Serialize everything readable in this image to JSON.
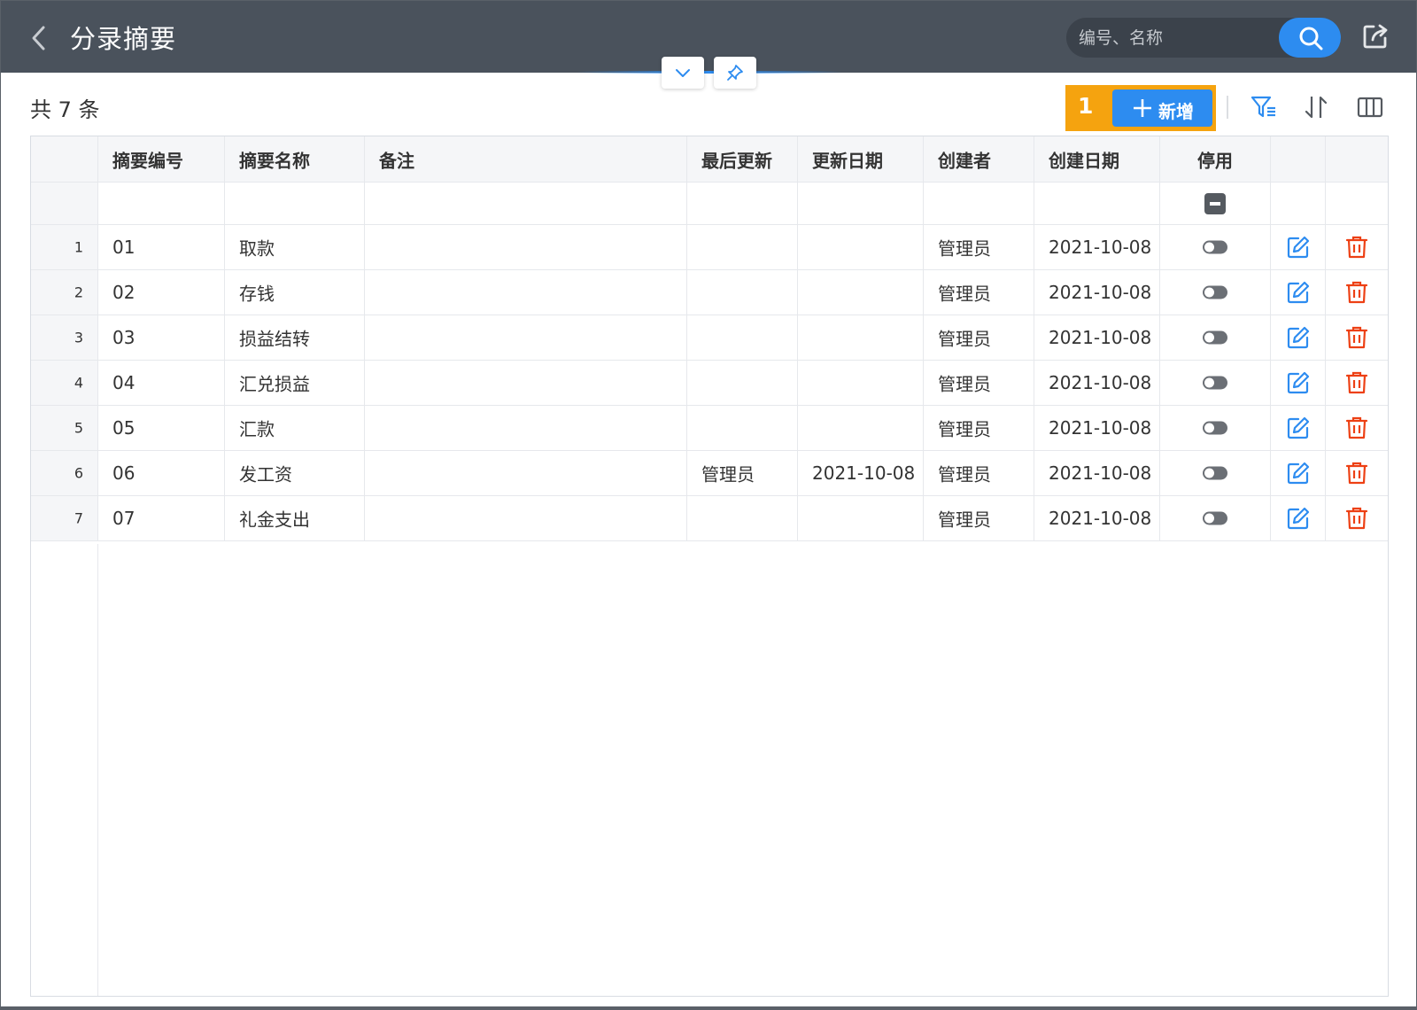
{
  "header": {
    "title": "分录摘要",
    "search_placeholder": "编号、名称"
  },
  "toolbar": {
    "total_label": "共 7 条",
    "step_badge": "1",
    "add_label": "新增"
  },
  "table": {
    "columns": [
      "摘要编号",
      "摘要名称",
      "备注",
      "最后更新",
      "更新日期",
      "创建者",
      "创建日期",
      "停用"
    ],
    "rows": [
      {
        "num": "1",
        "code": "01",
        "name": "取款",
        "remark": "",
        "last_updated_by": "",
        "update_date": "",
        "creator": "管理员",
        "create_date": "2021-10-08",
        "disabled": false
      },
      {
        "num": "2",
        "code": "02",
        "name": "存钱",
        "remark": "",
        "last_updated_by": "",
        "update_date": "",
        "creator": "管理员",
        "create_date": "2021-10-08",
        "disabled": false
      },
      {
        "num": "3",
        "code": "03",
        "name": "损益结转",
        "remark": "",
        "last_updated_by": "",
        "update_date": "",
        "creator": "管理员",
        "create_date": "2021-10-08",
        "disabled": false
      },
      {
        "num": "4",
        "code": "04",
        "name": "汇兑损益",
        "remark": "",
        "last_updated_by": "",
        "update_date": "",
        "creator": "管理员",
        "create_date": "2021-10-08",
        "disabled": false
      },
      {
        "num": "5",
        "code": "05",
        "name": "汇款",
        "remark": "",
        "last_updated_by": "",
        "update_date": "",
        "creator": "管理员",
        "create_date": "2021-10-08",
        "disabled": false
      },
      {
        "num": "6",
        "code": "06",
        "name": "发工资",
        "remark": "",
        "last_updated_by": "管理员",
        "update_date": "2021-10-08",
        "creator": "管理员",
        "create_date": "2021-10-08",
        "disabled": false
      },
      {
        "num": "7",
        "code": "07",
        "name": "礼金支出",
        "remark": "",
        "last_updated_by": "",
        "update_date": "",
        "creator": "管理员",
        "create_date": "2021-10-08",
        "disabled": false
      }
    ]
  },
  "icons": {
    "back": "chevron-left-icon",
    "search": "search-icon",
    "export": "export-icon",
    "collapse": "chevron-down-icon",
    "pin": "pin-icon",
    "filter": "filter-icon",
    "sort": "sort-icon",
    "columns": "columns-icon",
    "edit": "edit-icon",
    "delete": "trash-icon"
  },
  "colors": {
    "header_bg": "#4a525c",
    "accent": "#2d8cf0",
    "highlight": "#f5a30f",
    "delete": "#ed4014"
  }
}
